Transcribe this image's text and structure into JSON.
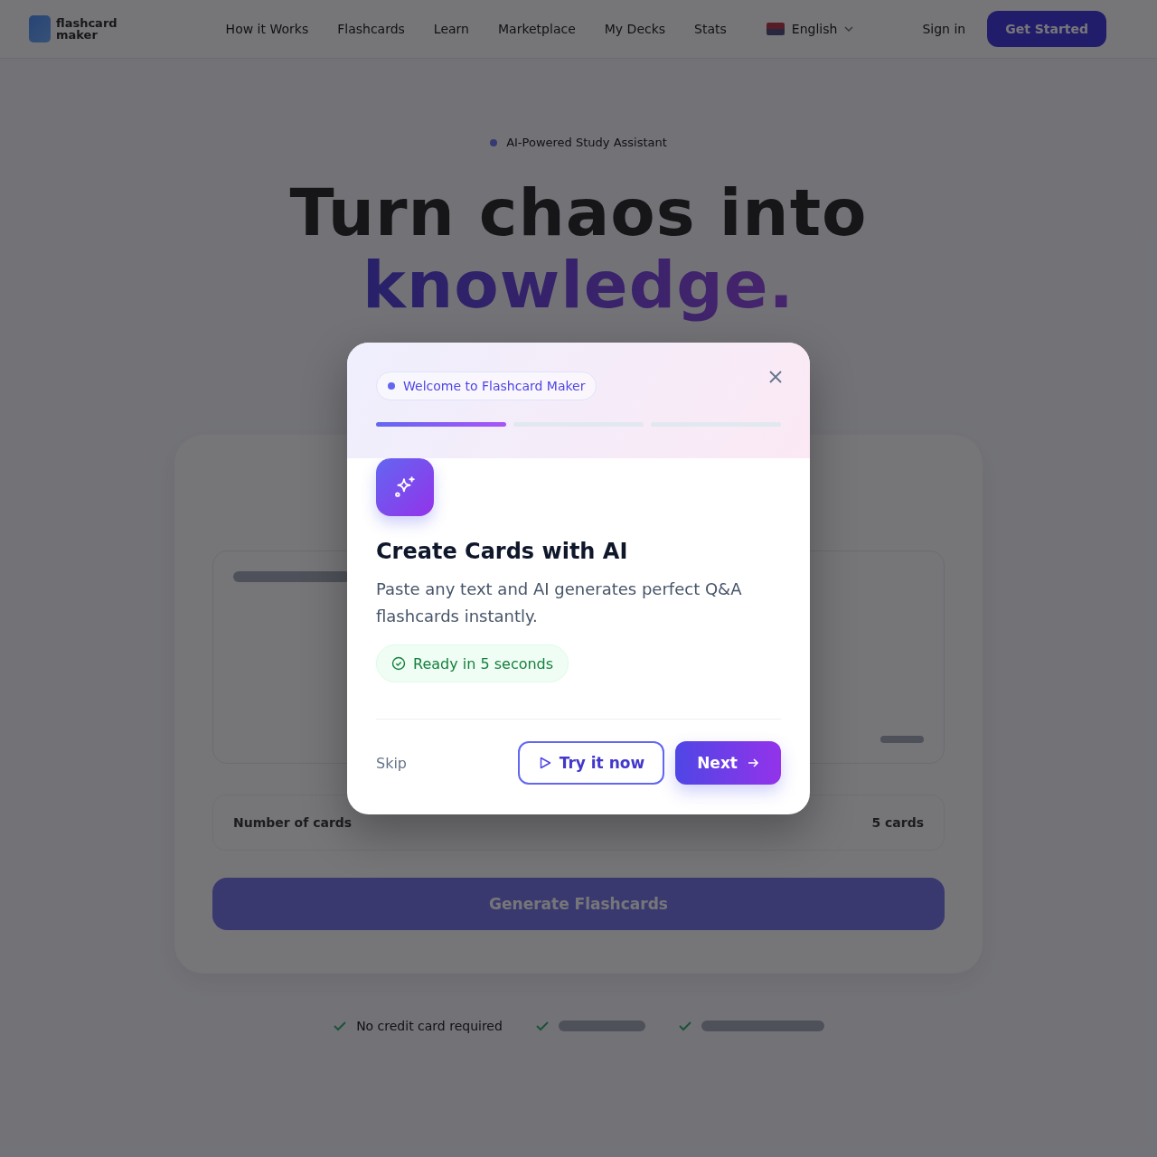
{
  "nav": {
    "logo": [
      "flashcard",
      "maker"
    ],
    "links": [
      {
        "label": "How it Works"
      },
      {
        "label": "Flashcards"
      },
      {
        "label": "Learn"
      },
      {
        "label": "Marketplace"
      },
      {
        "label": "My Decks"
      },
      {
        "label": "Stats"
      }
    ],
    "language": "English",
    "sign_in": "Sign in",
    "cta": "Get Started"
  },
  "hero": {
    "badge": "AI-Powered Study Assistant",
    "title_line1": "Turn chaos into",
    "title_line2": "knowledge."
  },
  "generator": {
    "count_label": "Number of cards",
    "count_value": "5 cards",
    "generate": "Generate Flashcards"
  },
  "perks": [
    "No credit card required"
  ],
  "dialog": {
    "badge": "Welcome to Flashcard Maker",
    "steps": [
      {
        "active": true
      },
      {
        "active": false
      },
      {
        "active": false
      }
    ],
    "title": "Create Cards with AI",
    "description": "Paste any text and AI generates perfect Q&A flashcards instantly.",
    "note": "Ready in 5 seconds",
    "skip": "Skip",
    "try": "Try it now",
    "next": "Next"
  }
}
